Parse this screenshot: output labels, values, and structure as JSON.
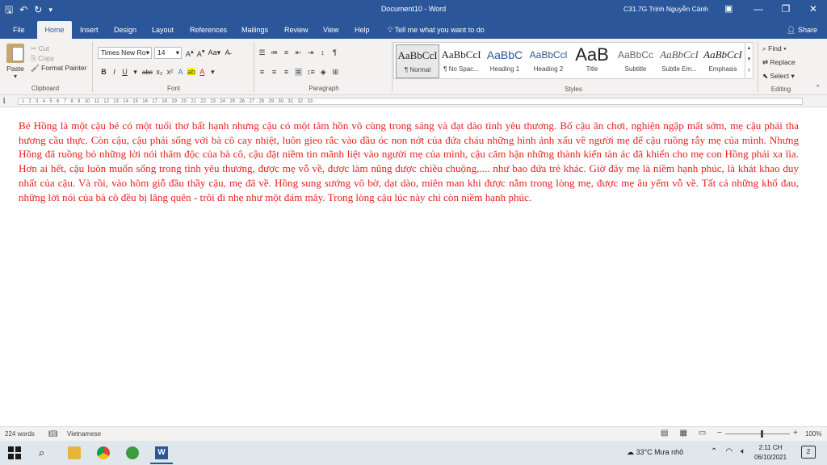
{
  "window": {
    "doc_title": "Document10 - Word",
    "user_name": "C31.7G Trịnh Nguyễn Cảnh"
  },
  "tabs": [
    {
      "label": "File"
    },
    {
      "label": "Home"
    },
    {
      "label": "Insert"
    },
    {
      "label": "Design"
    },
    {
      "label": "Layout"
    },
    {
      "label": "References"
    },
    {
      "label": "Mailings"
    },
    {
      "label": "Review"
    },
    {
      "label": "View"
    },
    {
      "label": "Help"
    }
  ],
  "tell_me": "Tell me what you want to do",
  "share": "Share",
  "clipboard": {
    "paste": "Paste",
    "cut": "Cut",
    "copy": "Copy",
    "format_painter": "Format Painter",
    "label": "Clipboard"
  },
  "font": {
    "name": "Times New Ro",
    "size": "14",
    "label": "Font"
  },
  "paragraph": {
    "label": "Paragraph"
  },
  "styles": {
    "label": "Styles",
    "items": [
      {
        "preview": "AaBbCcI",
        "name": "¶ Normal"
      },
      {
        "preview": "AaBbCcI",
        "name": "¶ No Spac..."
      },
      {
        "preview": "AaBbC",
        "name": "Heading 1"
      },
      {
        "preview": "AaBbCcl",
        "name": "Heading 2"
      },
      {
        "preview": "AaB",
        "name": "Title"
      },
      {
        "preview": "AaBbCc",
        "name": "Subtitle"
      },
      {
        "preview": "AaBbCcI",
        "name": "Subtle Em..."
      },
      {
        "preview": "AaBbCcI",
        "name": "Emphasis"
      }
    ]
  },
  "editing": {
    "find": "Find",
    "replace": "Replace",
    "select": "Select",
    "label": "Editing"
  },
  "document": {
    "text": "Bé Hồng là một cậu bé có một tuổi thơ bất hạnh nhưng cậu có một tâm hồn vô cùng trong sáng và đạt dào tình yêu thương. Bố cậu ăn chơi, nghiện ngập mất sớm, mẹ cậu phải tha hương cầu thực. Còn cậu, cậu phải sống với bà cô cay nhiệt, luôn gieo rắc vào đầu óc non nớt của đứa cháu những hình ảnh xấu về người mẹ để cậu ruồng rẫy mẹ của mình. Nhưng Hồng đã ruồng bỏ những lời nói thâm độc của bà cô, cậu đặt niềm tin mãnh liệt vào người mẹ của mình, cậu căm hận những thành kiến tàn ác đã khiến cho mẹ con Hồng phải xa lìa. Hơn ai hết, cậu luôn muốn sống trong tình yêu thương, được mẹ vỗ về, được làm nũng được chiều chuộng,.... như bao đứa trẻ khác. Giờ đây mẹ là niềm hạnh phúc, là khát khao duy nhất của cậu. Và rồi, vào hôm giỗ đầu thầy cậu, mẹ đã về. Hồng sung sướng vô bờ, dạt dào, miên man khi được nằm trong lòng mẹ, được mẹ âu yếm vỗ về. Tất cả những khổ đau, những lời nói của bà cô đều bị lãng quên - trôi đi nhẹ như một đám mây. Trong lòng cậu lúc này chỉ còn niềm hạnh phúc.",
    "text_color": "#e81e1e"
  },
  "status": {
    "words": "224 words",
    "language": "Vietnamese",
    "zoom": "100%",
    "zoom_level_percent": 100
  },
  "taskbar": {
    "weather": "33°C  Mưa nhỏ",
    "time": "2:11 CH",
    "date": "06/10/2021",
    "notifications": "2"
  },
  "colors": {
    "accent": "#2b579a",
    "ribbon_bg": "#f3f2f1"
  }
}
